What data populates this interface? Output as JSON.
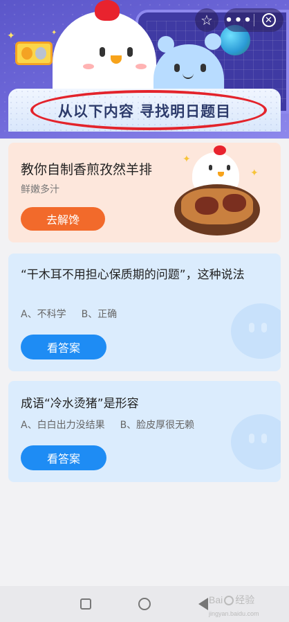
{
  "header": {
    "banner_text": "从以下内容 寻找明日题目",
    "star_icon": "☆",
    "more_icon": "•••",
    "close_icon": "✕"
  },
  "promo_card": {
    "title": "教你自制香煎孜然羊排",
    "subtitle": "鲜嫩多汁",
    "button_label": "去解馋"
  },
  "quiz_cards": [
    {
      "question": "“干木耳不用担心保质期的问题”，这种说法",
      "option_a": "A、不科学",
      "option_b": "B、正确",
      "button_label": "看答案"
    },
    {
      "question": "成语“冷水烫猪”是形容",
      "option_a": "A、白白出力没结果",
      "option_b": "B、脸皮厚很无赖",
      "button_label": "看答案"
    }
  ],
  "watermark": {
    "brand": "Bai",
    "suffix": "经验",
    "url": "jingyan.baidu.com"
  },
  "colors": {
    "header_purple": "#5b56c9",
    "promo_orange": "#f26a2b",
    "answer_blue": "#1e8cf4",
    "annotation_red": "#e3232b"
  }
}
